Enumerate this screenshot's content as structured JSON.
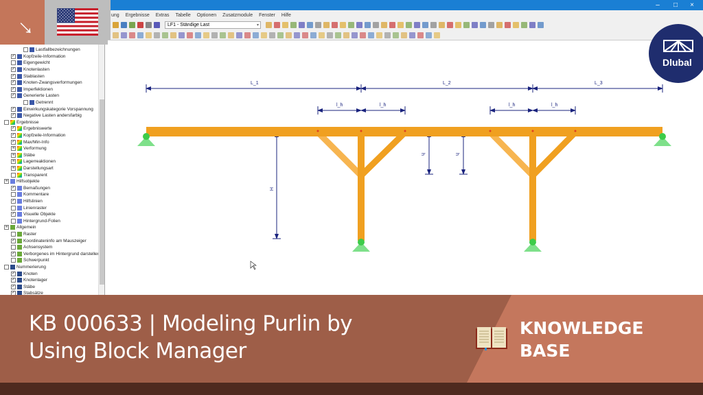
{
  "window": {
    "minimize": "–",
    "maximize": "□",
    "close": "×"
  },
  "menu": [
    "ung",
    "Ergebnisse",
    "Extras",
    "Tabelle",
    "Optionen",
    "Zusatzmodule",
    "Fenster",
    "Hilfe"
  ],
  "toolbar": {
    "load_case": "LF1 - Ständige Last"
  },
  "tree": [
    {
      "label": "Lastfallbezeichnungen",
      "level": 3,
      "checked": false,
      "icon": "load"
    },
    {
      "label": "Kopfzeile-Information",
      "level": 2,
      "checked": true,
      "icon": "load"
    },
    {
      "label": "Eigengewicht",
      "level": 2,
      "checked": false,
      "icon": "load"
    },
    {
      "label": "Knotenlasten",
      "level": 2,
      "checked": true,
      "icon": "load"
    },
    {
      "label": "Stablasten",
      "level": 2,
      "checked": true,
      "icon": "load"
    },
    {
      "label": "Knoten-Zwangsverformungen",
      "level": 2,
      "checked": true,
      "icon": "load"
    },
    {
      "label": "Imperfektionen",
      "level": 2,
      "checked": true,
      "icon": "load"
    },
    {
      "label": "Generierte Lasten",
      "level": 2,
      "checked": true,
      "icon": "load"
    },
    {
      "label": "Getrennt",
      "level": 3,
      "checked": false,
      "icon": "load"
    },
    {
      "label": "Einwirkungskategorie Vorspannung",
      "level": 2,
      "checked": true,
      "icon": "load"
    },
    {
      "label": "Negative Lasten andersfarbig",
      "level": 2,
      "checked": true,
      "icon": "load"
    },
    {
      "label": "Ergebnisse",
      "level": 1,
      "checked": false,
      "icon": "result"
    },
    {
      "label": "Ergebniswerte",
      "level": 2,
      "checked": true,
      "icon": "result"
    },
    {
      "label": "Kopfzeile-Information",
      "level": 2,
      "checked": true,
      "icon": "result"
    },
    {
      "label": "Max/Min-Info",
      "level": 2,
      "checked": true,
      "icon": "result"
    },
    {
      "label": "Verformung",
      "level": 2,
      "checked": "partial",
      "icon": "result"
    },
    {
      "label": "Stäbe",
      "level": 2,
      "checked": "partial",
      "icon": "result"
    },
    {
      "label": "Lagerreaktionen",
      "level": 2,
      "checked": "partial",
      "icon": "result"
    },
    {
      "label": "Darstellungsart",
      "level": 2,
      "checked": "partial",
      "icon": "result"
    },
    {
      "label": "Transparent",
      "level": 2,
      "checked": false,
      "icon": "result"
    },
    {
      "label": "Hilfsobjekte",
      "level": 1,
      "checked": "partial",
      "icon": "helper"
    },
    {
      "label": "Bemaßungen",
      "level": 2,
      "checked": true,
      "icon": "helper"
    },
    {
      "label": "Kommentare",
      "level": 2,
      "checked": false,
      "icon": "helper"
    },
    {
      "label": "Hilfslinien",
      "level": 2,
      "checked": true,
      "icon": "helper"
    },
    {
      "label": "Linienraster",
      "level": 2,
      "checked": false,
      "icon": "helper"
    },
    {
      "label": "Visuelle Objekte",
      "level": 2,
      "checked": true,
      "icon": "helper"
    },
    {
      "label": "Hintergrund-Folien",
      "level": 2,
      "checked": false,
      "icon": "helper"
    },
    {
      "label": "Allgemein",
      "level": 1,
      "checked": "partial",
      "icon": "general"
    },
    {
      "label": "Raster",
      "level": 2,
      "checked": false,
      "icon": "general"
    },
    {
      "label": "Koordinateninfo am Mauszeiger",
      "level": 2,
      "checked": true,
      "icon": "general"
    },
    {
      "label": "Achsensystem",
      "level": 2,
      "checked": false,
      "icon": "general"
    },
    {
      "label": "Verborgenes im Hintergrund darstellen",
      "level": 2,
      "checked": true,
      "icon": "general"
    },
    {
      "label": "Schwerpunkt",
      "level": 2,
      "checked": false,
      "icon": "general"
    },
    {
      "label": "Nummerierung",
      "level": 1,
      "checked": false,
      "icon": "number"
    },
    {
      "label": "Knoten",
      "level": 2,
      "checked": true,
      "icon": "number"
    },
    {
      "label": "Knotenlager",
      "level": 2,
      "checked": true,
      "icon": "number"
    },
    {
      "label": "Stäbe",
      "level": 2,
      "checked": true,
      "icon": "number"
    },
    {
      "label": "Stabsätze",
      "level": 2,
      "checked": true,
      "icon": "number"
    }
  ],
  "model": {
    "dims": {
      "L1": "L_1",
      "L2": "L_2",
      "L3": "L_3",
      "lh": "l_h",
      "H": "H",
      "h": "h"
    },
    "member_color": "#f0a020",
    "support_color": "#7ee08a"
  },
  "logo": {
    "text": "Dlubal"
  },
  "banner": {
    "title_line1": "KB 000633 | Modeling Purlin by",
    "title_line2": "Using Block Manager",
    "badge_line1": "KNOWLEDGE",
    "badge_line2": "BASE"
  }
}
